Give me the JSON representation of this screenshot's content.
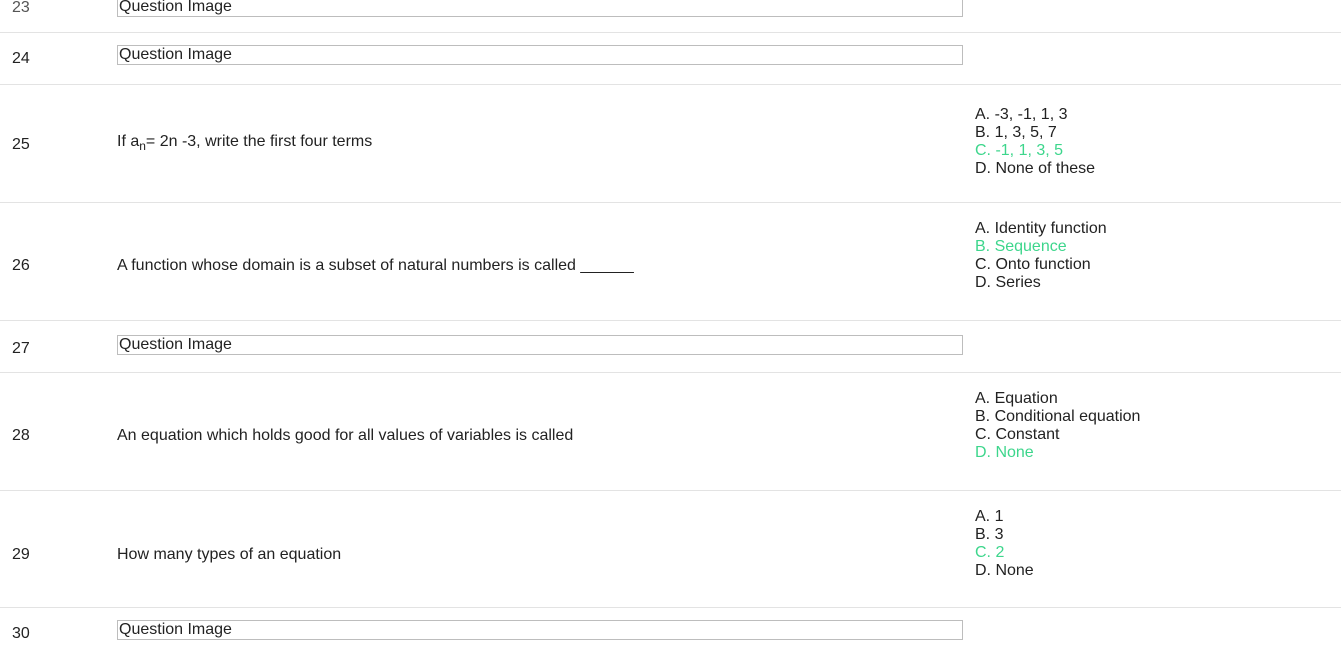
{
  "rows": [
    {
      "num": "23",
      "type": "image",
      "question": "Question Image"
    },
    {
      "num": "24",
      "type": "image",
      "question": "Question Image"
    },
    {
      "num": "25",
      "type": "text",
      "question_prefix": "If a",
      "question_sub": "n",
      "question_suffix": "= 2n -3, write the first four terms",
      "options": [
        "A. -3, -1, 1, 3",
        "B. 1, 3, 5, 7",
        "C. -1, 1, 3, 5",
        "D. None of these"
      ],
      "correct_index": 2
    },
    {
      "num": "26",
      "type": "text",
      "question": "A function whose domain is a subset of natural numbers is called ______",
      "options": [
        "A. Identity function",
        "B. Sequence",
        "C. Onto function",
        "D. Series"
      ],
      "correct_index": 1
    },
    {
      "num": "27",
      "type": "image",
      "question": "Question Image"
    },
    {
      "num": "28",
      "type": "text",
      "question": "An equation which holds good for all values of variables is called",
      "options": [
        "A. Equation",
        "B. Conditional equation",
        "C. Constant",
        "D. None"
      ],
      "correct_index": 3
    },
    {
      "num": "29",
      "type": "text",
      "question": "How many types of an equation",
      "options": [
        "A. 1",
        "B. 3",
        "C. 2",
        "D. None"
      ],
      "correct_index": 2
    },
    {
      "num": "30",
      "type": "image",
      "question": "Question Image"
    }
  ],
  "colors": {
    "correct": "#3dd68c",
    "text": "#222222",
    "divider": "#e3e3e3",
    "image_border": "#bdbdbd"
  }
}
